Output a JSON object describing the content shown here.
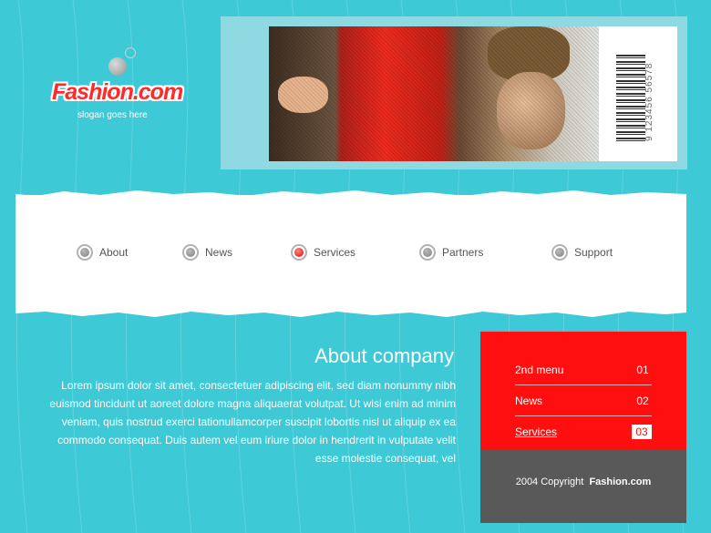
{
  "brand": {
    "logo": "Fashion.com",
    "slogan": "slogan goes here"
  },
  "header": {
    "barcode_number": "9 123456 56578"
  },
  "nav": [
    {
      "label": "About",
      "active": false
    },
    {
      "label": "News",
      "active": false
    },
    {
      "label": "Services",
      "active": true
    },
    {
      "label": "Partners",
      "active": false
    },
    {
      "label": "Support",
      "active": false
    }
  ],
  "about": {
    "title": "About company",
    "text": "Lorem ipsum dolor sit amet, consectetuer adipiscing elit, sed diam nonummy nibh euismod tincidunt ut aoreet dolore magna aliquaerat volutpat. Ut wisi enim ad minim veniam, quis nostrud exerci tationullamcorper suscipit lobortis nisl ut aliquip ex ea commodo consequat. Duis autem vel eum iriure dolor in hendrerit in vulputate velit esse molestie consequat, vel"
  },
  "side_menu": [
    {
      "label": "2nd menu",
      "num": "01",
      "current": false
    },
    {
      "label": "News",
      "num": "02",
      "current": false
    },
    {
      "label": "Services",
      "num": "03",
      "current": true
    }
  ],
  "footer": {
    "copyright_prefix": "2004 Copyright",
    "copyright_brand": "Fashion.com"
  },
  "colors": {
    "background": "#3ec9d6",
    "accent_red": "#ff0f0f",
    "footer_gray": "#595959",
    "logo_red": "#ff2a2a"
  }
}
